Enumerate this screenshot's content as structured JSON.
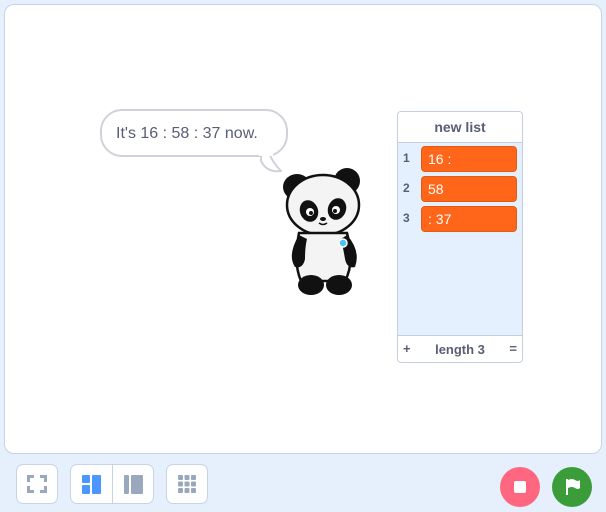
{
  "speech_bubble": {
    "text": "It's 16 : 58  : 37 now."
  },
  "list_monitor": {
    "title": "new list",
    "items": [
      {
        "index": "1",
        "value": "16 :"
      },
      {
        "index": "2",
        "value": "58"
      },
      {
        "index": "3",
        "value": ": 37"
      }
    ],
    "add_label": "+",
    "length_label": "length 3",
    "resize_label": "="
  },
  "controls": {
    "fullscreen_icon": "fullscreen-icon",
    "small_stage_icon": "small-stage-layout-icon",
    "large_stage_icon": "large-stage-layout-icon",
    "grid_icon": "grid-icon",
    "stop_icon": "stop-icon",
    "green_flag_icon": "green-flag-icon"
  },
  "colors": {
    "list_item": "#ff661a",
    "stop": "#ff6680",
    "go": "#3a9d3a",
    "active_layout": "#4c97ff"
  }
}
